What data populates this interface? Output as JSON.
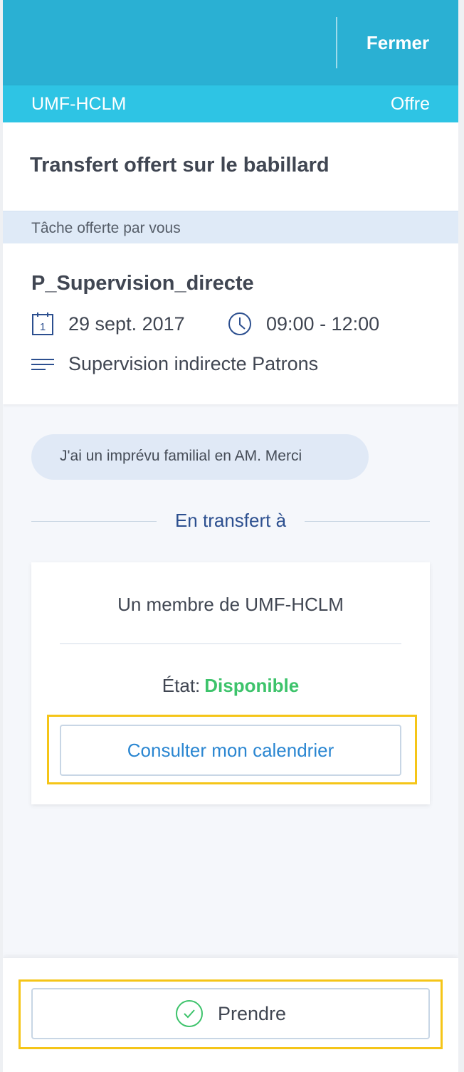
{
  "header": {
    "close_label": "Fermer"
  },
  "subheader": {
    "group": "UMF-HCLM",
    "type": "Offre"
  },
  "title": "Transfert offert sur le babillard",
  "section_label": "Tâche offerte par vous",
  "task": {
    "name": "P_Supervision_directe",
    "date": "29 sept. 2017",
    "calendar_day": "1",
    "time": "09:00 - 12:00",
    "description": "Supervision indirecte Patrons"
  },
  "message": "J'ai un imprévu familial en AM. Merci",
  "transfer_label": "En transfert à",
  "member_card": {
    "recipient": "Un membre de UMF-HCLM",
    "state_label": "État:",
    "state_value": "Disponible",
    "calendar_button": "Consulter mon calendrier"
  },
  "footer": {
    "take_button": "Prendre"
  },
  "colors": {
    "header": "#2ab0d3",
    "subheader": "#2ec4e4",
    "available": "#3dc36b",
    "link": "#2a86d1",
    "highlight": "#f5c518"
  }
}
